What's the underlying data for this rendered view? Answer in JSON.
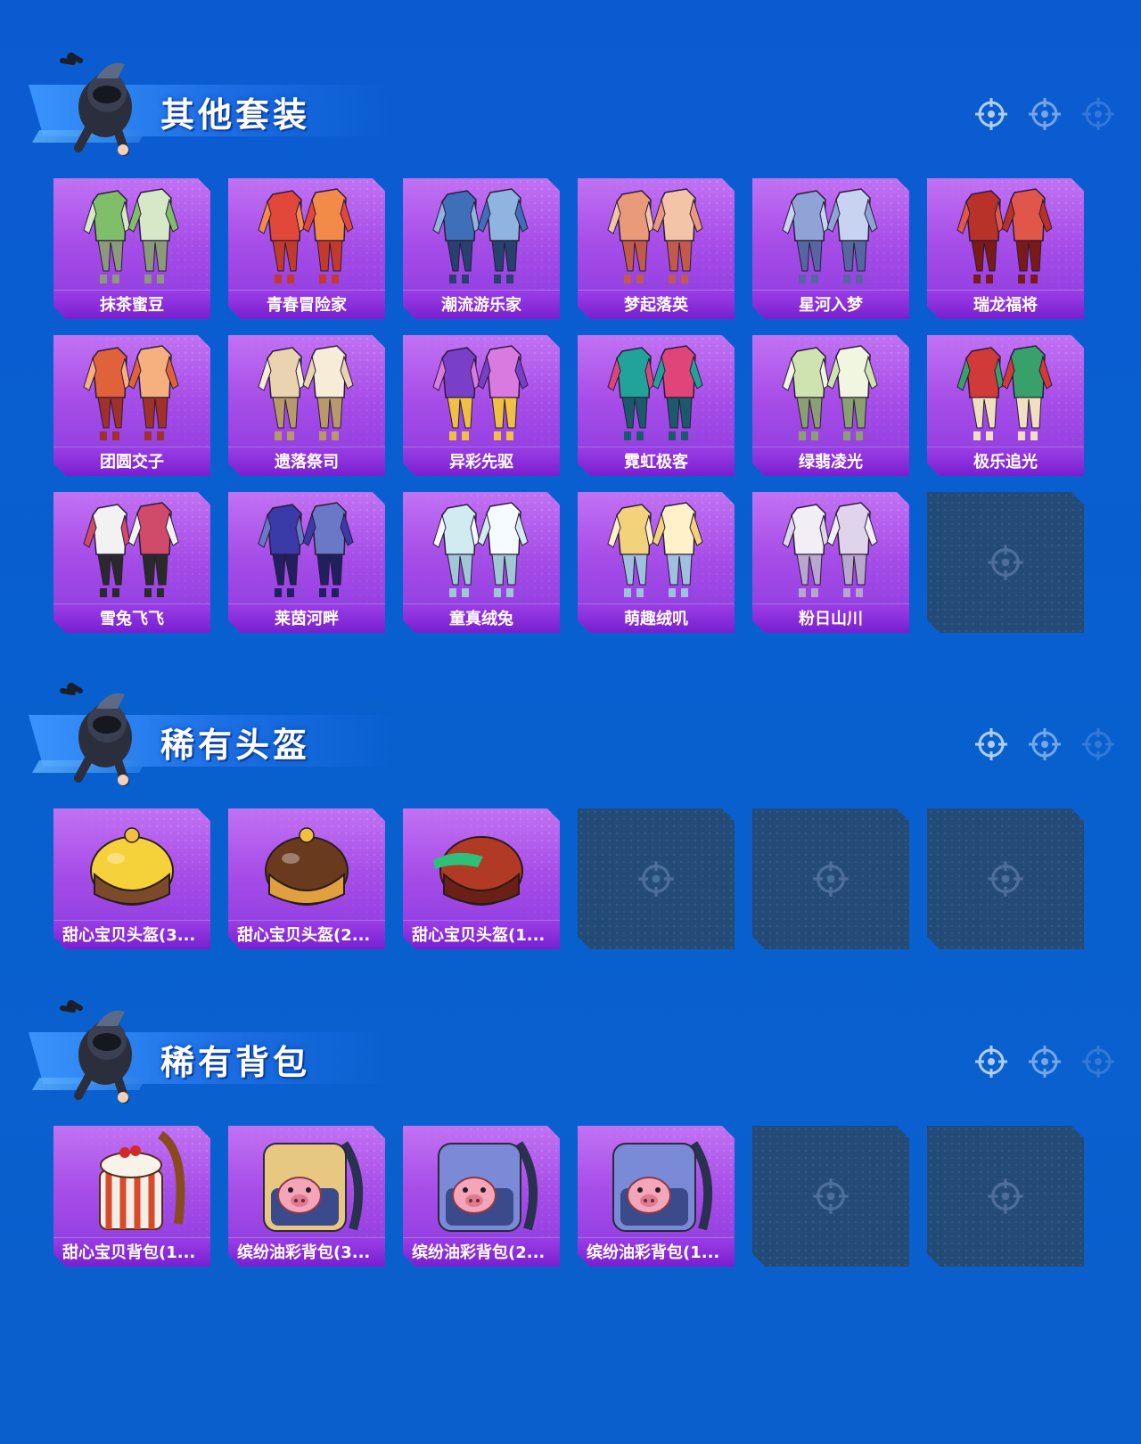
{
  "sections": [
    {
      "title": "其他套装",
      "items": [
        "抹茶蜜豆",
        "青春冒险家",
        "潮流游乐家",
        "梦起落英",
        "星河入梦",
        "瑞龙福将",
        "团圆交子",
        "遗落祭司",
        "异彩先驱",
        "霓虹极客",
        "绿翡凌光",
        "极乐追光",
        "雪兔飞飞",
        "莱茵河畔",
        "童真绒兔",
        "萌趣绒叽",
        "粉日山川"
      ],
      "empty_slots": 1
    },
    {
      "title": "稀有头盔",
      "items": [
        "甜心宝贝头盔(3...",
        "甜心宝贝头盔(2...",
        "甜心宝贝头盔(1..."
      ],
      "empty_slots": 3
    },
    {
      "title": "稀有背包",
      "items": [
        "甜心宝贝背包(1...",
        "缤纷油彩背包(3...",
        "缤纷油彩背包(2...",
        "缤纷油彩背包(1..."
      ],
      "empty_slots": 2
    }
  ],
  "icons": {
    "header_decor": [
      "crosshair-icon",
      "crosshair-icon",
      "crosshair-icon"
    ],
    "empty_slot": "crosshair-icon",
    "mascot": "skydiver-mascot-icon"
  },
  "colors": {
    "background": "#0a5bd0",
    "card_purple": "#a74ee8",
    "label_purple": "#7a1fd0",
    "empty_slot": "#244a78"
  }
}
